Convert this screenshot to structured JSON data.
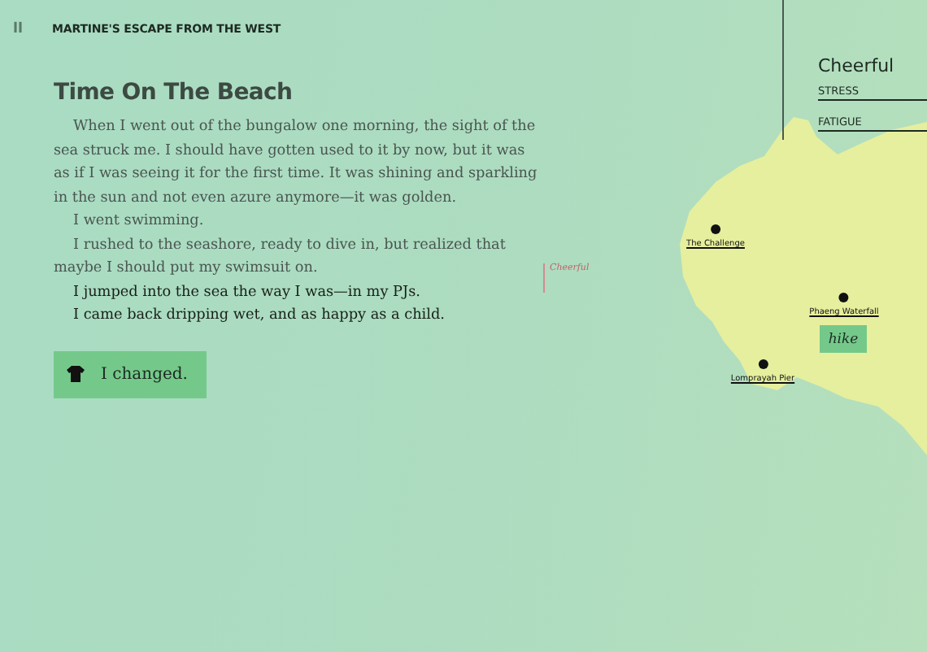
{
  "header": {
    "menu_icon": "II",
    "title": "MARTINE'S ESCAPE FROM THE WEST"
  },
  "chapter": {
    "title": "Time On The Beach",
    "paragraphs": [
      {
        "text": "When I went out of the bungalow one morning, the sight of the sea struck me. I should have gotten used to it by now, but it was as if I was seeing it for the first time. It was shining and sparkling in the sun and not even azure anymore—it was golden.",
        "chosen": false
      },
      {
        "text": "I went swimming.",
        "chosen": false
      },
      {
        "text": "I rushed to the seashore, ready to dive in, but realized that maybe I should put my swimsuit on.",
        "chosen": false
      },
      {
        "text": "I jumped into the sea the way I was—in my PJs.",
        "chosen": true
      },
      {
        "text": "I came back dripping wet, and as happy as a child.",
        "chosen": true
      }
    ],
    "choice": {
      "label": "I changed."
    }
  },
  "mood_marker": {
    "label": "Cheerful"
  },
  "status": {
    "mood": "Cheerful",
    "meters": [
      {
        "label": "STRESS"
      },
      {
        "label": "FATIGUE"
      }
    ]
  },
  "map": {
    "places": [
      {
        "name": "The Challenge"
      },
      {
        "name": "Phaeng Waterfall"
      },
      {
        "name": "Lomprayah Pier"
      }
    ],
    "action": {
      "label": "hike"
    }
  }
}
